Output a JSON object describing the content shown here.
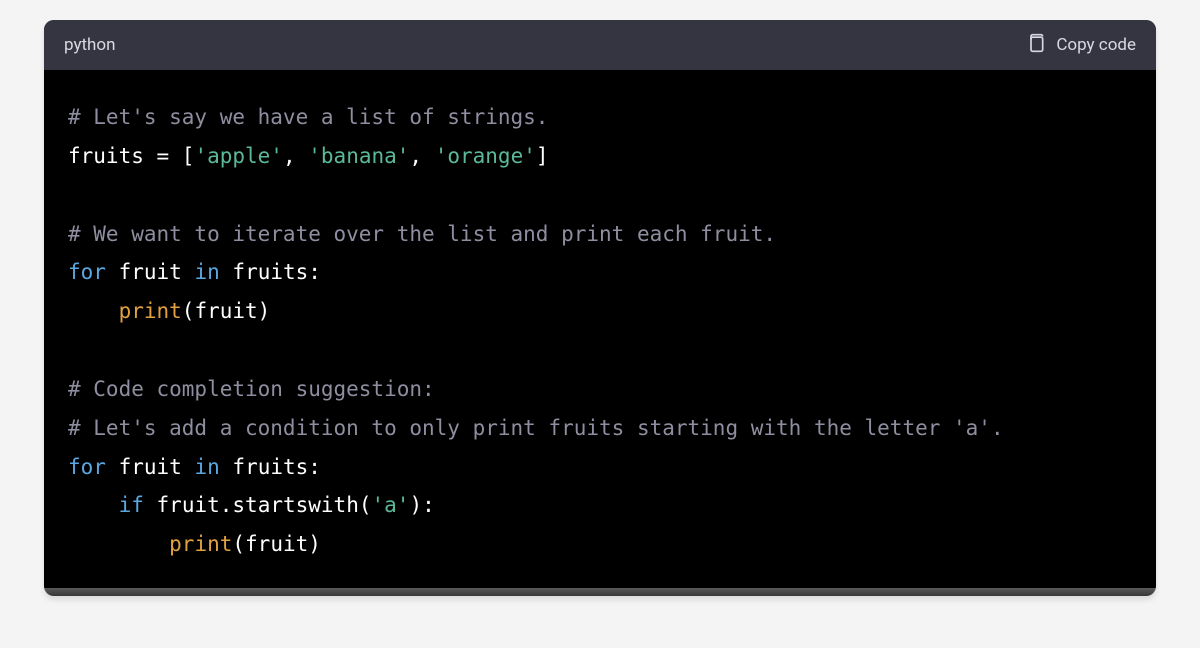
{
  "header": {
    "language": "python",
    "copy_label": "Copy code"
  },
  "code": {
    "line1_comment": "# Let's say we have a list of strings.",
    "line2_var": "fruits",
    "line2_eq": " = ",
    "line2_b1": "[",
    "line2_s1": "'apple'",
    "line2_c1": ", ",
    "line2_s2": "'banana'",
    "line2_c2": ", ",
    "line2_s3": "'orange'",
    "line2_b2": "]",
    "line4_comment": "# We want to iterate over the list and print each fruit.",
    "line5_for": "for",
    "line5_sp1": " ",
    "line5_item": "fruit",
    "line5_sp2": " ",
    "line5_in": "in",
    "line5_sp3": " ",
    "line5_iter": "fruits",
    "line5_colon": ":",
    "line6_indent": "    ",
    "line6_fn": "print",
    "line6_p1": "(",
    "line6_arg": "fruit",
    "line6_p2": ")",
    "line8_comment": "# Code completion suggestion:",
    "line9_comment": "# Let's add a condition to only print fruits starting with the letter 'a'.",
    "line10_for": "for",
    "line10_sp1": " ",
    "line10_item": "fruit",
    "line10_sp2": " ",
    "line10_in": "in",
    "line10_sp3": " ",
    "line10_iter": "fruits",
    "line10_colon": ":",
    "line11_indent": "    ",
    "line11_if": "if",
    "line11_sp": " ",
    "line11_obj": "fruit",
    "line11_dot": ".",
    "line11_method": "startswith",
    "line11_p1": "(",
    "line11_arg": "'a'",
    "line11_p2": ")",
    "line11_colon": ":",
    "line12_indent": "        ",
    "line12_fn": "print",
    "line12_p1": "(",
    "line12_arg": "fruit",
    "line12_p2": ")"
  }
}
